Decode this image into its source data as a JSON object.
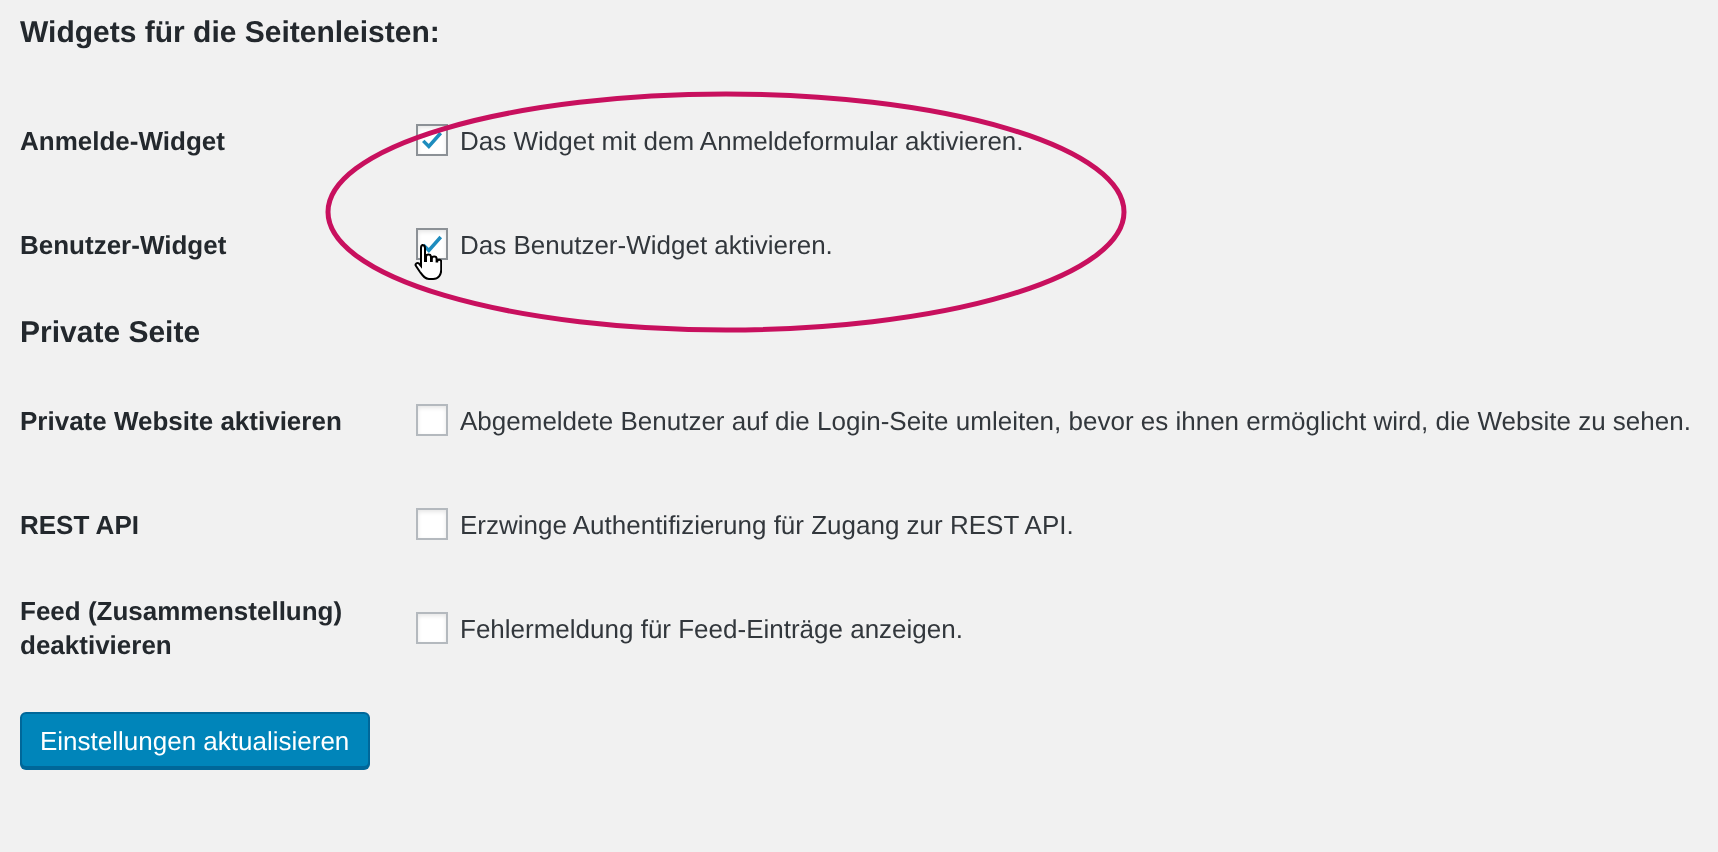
{
  "sections": [
    {
      "heading": "Widgets für die Seitenleisten:",
      "rows": [
        {
          "label": "Anmelde-Widget",
          "checked": true,
          "text": "Das Widget mit dem Anmeldeformular aktivieren."
        },
        {
          "label": "Benutzer-Widget",
          "checked": true,
          "text": "Das Benutzer-Widget aktivieren."
        }
      ]
    },
    {
      "heading": "Private Seite",
      "rows": [
        {
          "label": "Private Website aktivieren",
          "checked": false,
          "text": "Abgemeldete Benutzer auf die Login-Seite umleiten, bevor es ihnen ermöglicht wird, die Website zu sehen."
        },
        {
          "label": "REST API",
          "checked": false,
          "text": "Erzwinge Authentifizierung für Zugang zur REST API."
        },
        {
          "label": "Feed (Zusammenstellung) deaktivieren",
          "checked": false,
          "text": "Fehlermeldung für Feed-Einträge anzeigen."
        }
      ]
    }
  ],
  "submit_button": "Einstellungen aktualisieren"
}
